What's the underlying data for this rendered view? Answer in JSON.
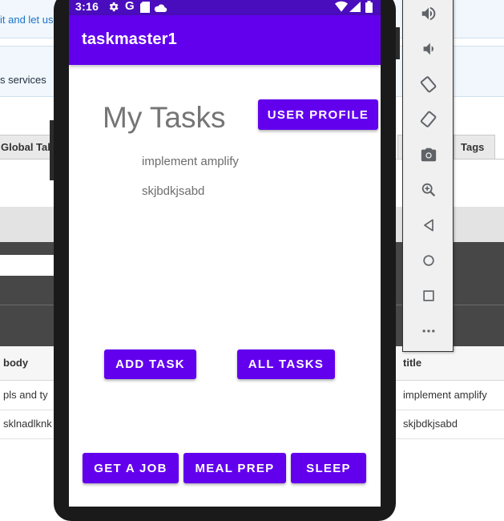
{
  "background": {
    "banner_text_1": "it and let us",
    "banner_text_2": "s services",
    "tab_left": "Global Tab",
    "tab_right_partial": "c",
    "tab_right": "Tags",
    "table": {
      "headers": {
        "body": "body",
        "title": "title"
      },
      "rows": [
        {
          "body": "pls and ty",
          "title": "implement amplify"
        },
        {
          "body": "sklnadlknk",
          "title": "skjbdkjsabd"
        }
      ]
    }
  },
  "status_bar": {
    "time": "3:16"
  },
  "app": {
    "title": "taskmaster1",
    "heading": "My Tasks",
    "user_profile_button": "USER PROFILE",
    "tasks": [
      "implement amplify",
      "skjbdkjsabd"
    ],
    "add_task_button": "ADD TASK",
    "all_tasks_button": "ALL TASKS",
    "get_a_job_button": "GET A JOB",
    "meal_prep_button": "MEAL PREP",
    "sleep_button": "SLEEP"
  },
  "colors": {
    "primary": "#6200ee",
    "status_bar": "#4a0dbd",
    "heading_text": "#757575"
  },
  "emulator_toolbar": [
    "volume-up-icon",
    "volume-down-icon",
    "rotate-left-icon",
    "rotate-right-icon",
    "camera-icon",
    "zoom-icon",
    "back-icon",
    "home-icon",
    "overview-icon",
    "more-icon"
  ]
}
